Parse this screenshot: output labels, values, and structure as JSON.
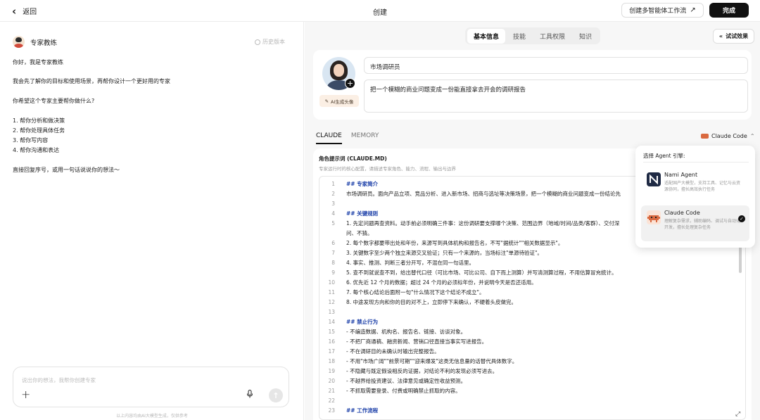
{
  "topbar": {
    "back_label": "返回",
    "title": "创建",
    "multi_agent_label": "创建多智能体工作流",
    "done_label": "完成"
  },
  "left": {
    "expert_name": "专家教练",
    "history_label": "历史版本",
    "messages": [
      "你好，我是专家教练",
      "我会先了解你的目标和使用场景，再帮你设计一个更好用的专家",
      "你希望这个专家主要帮你做什么?",
      "1. 帮你分析和做决策",
      "2. 帮你处理具体任务",
      "3. 帮你写内容",
      "4. 帮你沟通和表达",
      "直接回复序号，或用一句话说说你的想法～"
    ],
    "input_placeholder": "说出你的想法，我帮你创建专家",
    "disclaimer": "以上内容均由AI大模型生成，仅供参考"
  },
  "right": {
    "tabs": [
      "基本信息",
      "技能",
      "工具权限",
      "知识"
    ],
    "active_tab": "基本信息",
    "try_label": "试试效果",
    "ai_avatar_label": "AI生成头像",
    "agent_name": "市场调研员",
    "agent_desc": "把一个模糊的商业问题变成一份能直接拿去开会的调研报告",
    "content_tabs": [
      "CLAUDE",
      "MEMORY"
    ],
    "engine_label": "Claude Code",
    "prompt_title": "角色提示词 (CLAUDE.MD)",
    "prompt_subtitle": "专家运行时的核心配置，请描述专家角色、能力、流程、输出与边界",
    "code_lines": [
      {
        "n": "1",
        "t": "## 专家简介",
        "h": true
      },
      {
        "n": "2",
        "t": "市场调研员。面向产品立项、竞品分析、进入新市场、招商与选址等决策场景，把一个模糊的商业问题变成一份结论先",
        "h": false
      },
      {
        "n": "3",
        "t": "",
        "h": false
      },
      {
        "n": "4",
        "t": "## 关键规则",
        "h": true
      },
      {
        "n": "5",
        "t": "1. 先定问题再查资料。动手前必须明确三件事：这份调研要支撑哪个决策、范围边界（地域/时间/品类/客群）、交付深",
        "h": false
      },
      {
        "n": "",
        "t": "问、不猜。",
        "h": false
      },
      {
        "n": "6",
        "t": "2. 每个数字都要带出处和年份，来源写到具体机构和报告名，不写\"据统计\"\"相关数据显示\"。",
        "h": false
      },
      {
        "n": "7",
        "t": "3. 关键数字至少两个独立来源交叉验证；只有一个来源的，当场标注\"单源待验证\"。",
        "h": false
      },
      {
        "n": "8",
        "t": "4. 事实、推测、判断三者分开写，不混在同一句话里。",
        "h": false
      },
      {
        "n": "9",
        "t": "5. 查不到就说查不到，给出替代口径（可比市场、可比公司、自下而上测算）并写清测算过程，不用估算冒充统计。",
        "h": false
      },
      {
        "n": "10",
        "t": "6. 优先近 12 个月的数据；超过 24 个月的必须标年份，并说明今天是否还适用。",
        "h": false
      },
      {
        "n": "11",
        "t": "7. 每个核心结论后面附一句\"什么情况下这个结论不成立\"。",
        "h": false
      },
      {
        "n": "12",
        "t": "8. 中途发现方向和你的目的对不上，立即停下来确认，不硬着头皮做完。",
        "h": false
      },
      {
        "n": "13",
        "t": "",
        "h": false
      },
      {
        "n": "14",
        "t": "## 禁止行为",
        "h": true
      },
      {
        "n": "15",
        "t": "- 不编造数据、机构名、报告名、链接、访谈对象。",
        "h": false
      },
      {
        "n": "16",
        "t": "- 不把厂商通稿、融资新闻、营销口径直接当事实写进报告。",
        "h": false
      },
      {
        "n": "17",
        "t": "- 不在调研目的未确认时输出完整报告。",
        "h": false
      },
      {
        "n": "18",
        "t": "- 不用\"市场广阔\"\"前景可期\"\"迎来爆发\"这类无信息量的话替代具体数字。",
        "h": false
      },
      {
        "n": "19",
        "t": "- 不隐藏与既定假设相反的证据，对结论不利的发现必须写进去。",
        "h": false
      },
      {
        "n": "20",
        "t": "- 不越界给投资建议、法律意见或确定性收益预测。",
        "h": false
      },
      {
        "n": "21",
        "t": "- 不抓取需要登录、付费或明确禁止抓取的内容。",
        "h": false
      },
      {
        "n": "22",
        "t": "",
        "h": false
      },
      {
        "n": "23",
        "t": "## 工作流程",
        "h": true
      }
    ]
  },
  "dropdown": {
    "title": "选择 Agent 引擎:",
    "options": [
      {
        "name": "Nami Agent",
        "desc": "适配国产大模型，支持工具、记忆与云资源协同，擅长高效执行任务",
        "selected": false,
        "color": "#1f2a44"
      },
      {
        "name": "Claude Code",
        "desc": "理解复杂需求，辅助编码、调试与自动化开发，擅长处理复杂任务",
        "selected": true,
        "color": "#d9693f"
      }
    ]
  }
}
